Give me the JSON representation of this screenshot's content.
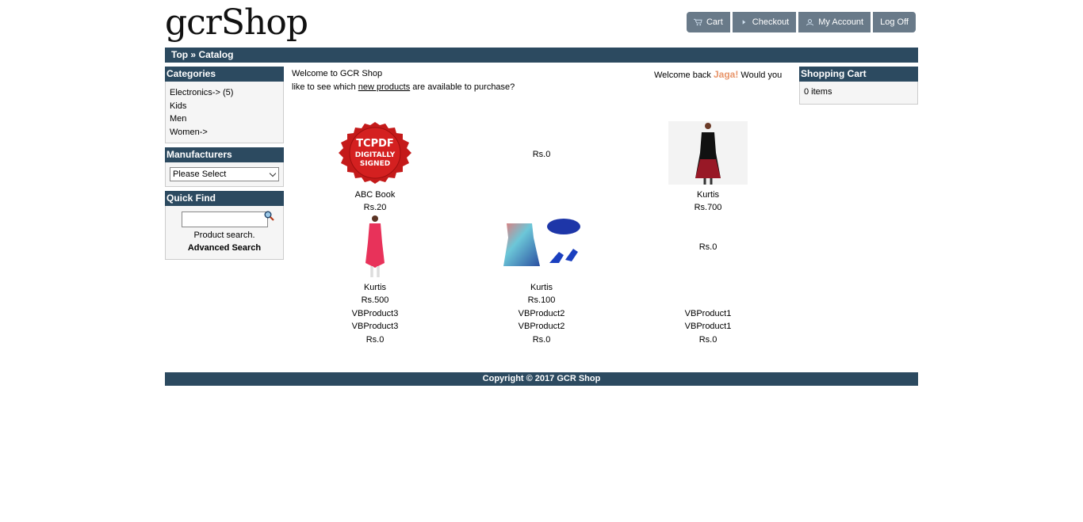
{
  "header": {
    "logo": "gcrShop",
    "nav": [
      {
        "label": "Cart",
        "icon": "cart-icon"
      },
      {
        "label": "Checkout",
        "icon": "triangle-right-icon"
      },
      {
        "label": "My Account",
        "icon": "user-icon"
      },
      {
        "label": "Log Off",
        "icon": ""
      }
    ]
  },
  "breadcrumb": "Top » Catalog",
  "sidebar": {
    "categories": {
      "title": "Categories",
      "items": [
        "Electronics-> (5)",
        "Kids",
        "Men",
        "Women->"
      ]
    },
    "manufacturers": {
      "title": "Manufacturers",
      "select_value": "Please Select"
    },
    "quickfind": {
      "title": "Quick Find",
      "hint": "Product search.",
      "advanced": "Advanced Search"
    }
  },
  "main": {
    "welcome": "Welcome to GCR Shop",
    "welcome_back_pre": "Welcome back ",
    "user": "Jaga!",
    "welcome_back_post": " Would you",
    "line2_pre": "like to see which ",
    "line2_link": "new products",
    "line2_post": " are available to purchase?",
    "products": [
      {
        "name": "ABC Book",
        "price": "Rs.20",
        "image": "tcpdf-seal"
      },
      {
        "name": "",
        "price": "Rs.0",
        "image": ""
      },
      {
        "name": "Kurtis",
        "price": "Rs.700",
        "image": "black-dress"
      },
      {
        "name": "Kurtis",
        "price": "Rs.500",
        "image": "pink-kurti"
      },
      {
        "name": "Kurtis",
        "price": "Rs.100",
        "image": "blue-outfit"
      },
      {
        "name": "",
        "price": "Rs.0",
        "image": ""
      },
      {
        "name": "VBProduct3",
        "name2": "VBProduct3",
        "price": "Rs.0"
      },
      {
        "name": "VBProduct2",
        "name2": "VBProduct2",
        "price": "Rs.0"
      },
      {
        "name": "VBProduct1",
        "name2": "VBProduct1",
        "price": "Rs.0"
      }
    ],
    "tcpdf_text": [
      "TCPDF",
      "DIGITALLY",
      "SIGNED"
    ]
  },
  "cart": {
    "title": "Shopping Cart",
    "items": "0 items"
  },
  "footer": "Copyright © 2017 GCR Shop",
  "colors": {
    "bar": "#2c4a60",
    "nav": "#697a89",
    "user": "#e8956a"
  }
}
